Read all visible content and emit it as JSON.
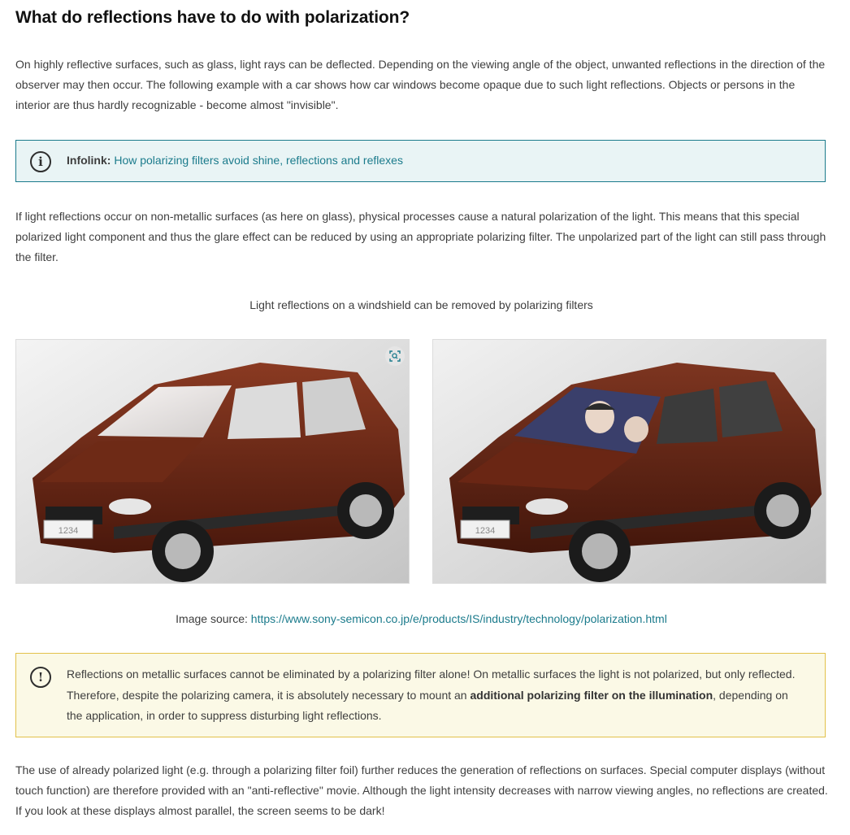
{
  "heading": "What do reflections have to do with polarization?",
  "paragraph1": "On highly reflective surfaces, such as glass, light rays can be deflected. Depending on the viewing angle of the object, unwanted reflections in the direction of the observer may then occur. The following example with a car shows how car windows become opaque due to such light reflections. Objects or persons in the interior are thus hardly recognizable - become almost \"invisible\".",
  "infobox": {
    "icon": "info-icon",
    "label": "Infolink:",
    "link_text": "How polarizing filters avoid shine, reflections and reflexes"
  },
  "paragraph2": "If light reflections occur on non-metallic surfaces (as here on glass), physical processes cause a natural polarization of the light. This means that this special polarized light component and thus the glare effect can be reduced by using an appropriate polarizing filter. The unpolarized part of the light can still pass through the filter.",
  "figure": {
    "caption": "Light reflections on a windshield can be removed by polarizing filters",
    "zoom_icon": "zoom-icon",
    "source_label": "Image source:",
    "source_link": "https://www.sony-semicon.co.jp/e/products/IS/industry/technology/polarization.html",
    "plate_text": "1234"
  },
  "warning": {
    "icon": "exclamation-icon",
    "text_before": "Reflections on metallic surfaces cannot be eliminated by a polarizing filter alone! On metallic surfaces the light is not polarized, but only reflected. Therefore, despite the polarizing camera, it is absolutely necessary to mount an ",
    "text_bold": "additional polarizing filter on the illumination",
    "text_after": ", depending on the application, in order to suppress disturbing light reflections."
  },
  "paragraph3": "The use of already polarized light (e.g. through a polarizing filter foil) further reduces the generation of reflections on surfaces. Special computer displays (without touch function) are therefore provided with an \"anti-reflective\"  movie. Although the light intensity decreases with narrow viewing angles, no reflections are created. If you look at these displays almost parallel, the screen seems to be dark!",
  "colors": {
    "link": "#1b7b8c",
    "info_bg": "#e9f4f5",
    "warn_bg": "#fbf9e6",
    "warn_border": "#e2c14a"
  }
}
